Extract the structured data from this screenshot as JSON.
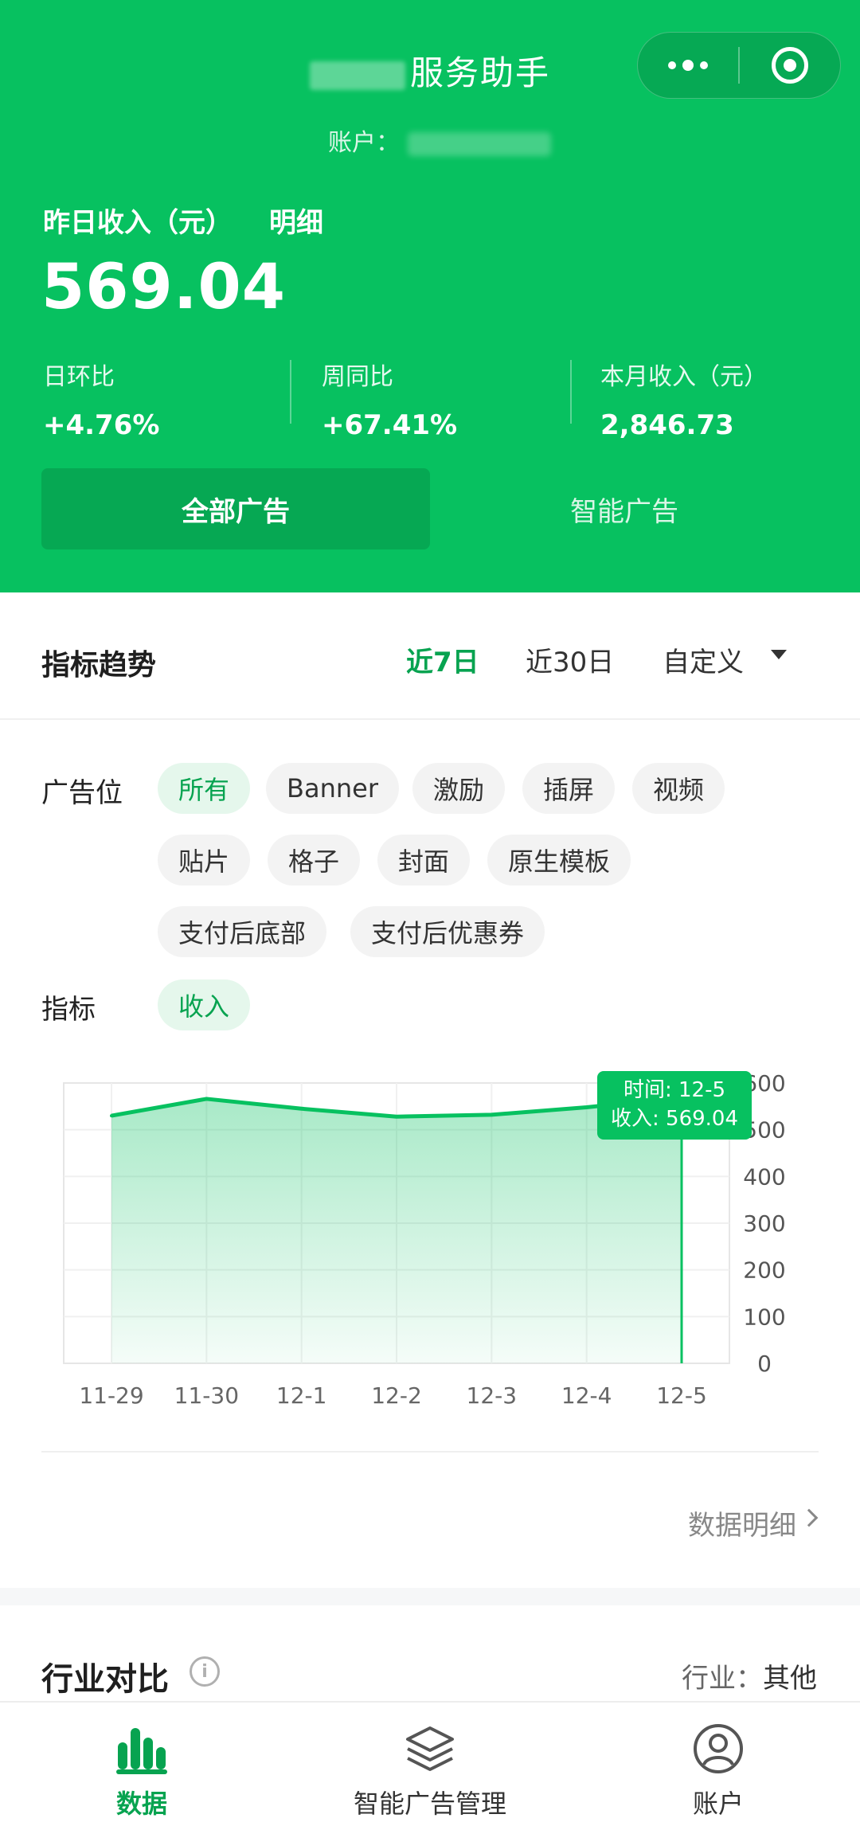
{
  "header": {
    "app_title": "服务助手",
    "account_label": "账户：",
    "yesterday_label": "昨日收入（元）",
    "detail_link": "明细",
    "yesterday_value": "569.04",
    "stats": [
      {
        "label": "日环比",
        "value": "+4.76%"
      },
      {
        "label": "周同比",
        "value": "+67.41%"
      },
      {
        "label": "本月收入（元）",
        "value": "2,846.73"
      }
    ],
    "segments": {
      "all": "全部广告",
      "smart": "智能广告"
    }
  },
  "trend": {
    "title": "指标趋势",
    "ranges": [
      "近7日",
      "近30日",
      "自定义"
    ],
    "selected_range": "近7日",
    "ad_position_label": "广告位",
    "ad_positions": [
      "所有",
      "Banner",
      "激励",
      "插屏",
      "视频",
      "贴片",
      "格子",
      "封面",
      "原生模板",
      "支付后底部",
      "支付后优惠券"
    ],
    "metric_label": "指标",
    "metric": "收入"
  },
  "chart_data": {
    "type": "area",
    "categories": [
      "11-29",
      "11-30",
      "12-1",
      "12-2",
      "12-3",
      "12-4",
      "12-5"
    ],
    "values": [
      530,
      566,
      545,
      528,
      532,
      548,
      569.04
    ],
    "yticks": [
      0,
      100,
      200,
      300,
      400,
      500,
      600
    ],
    "ylim": [
      0,
      600
    ],
    "tooltip": {
      "time_label": "时间: 12-5",
      "value_label": "收入: 569.04"
    },
    "color": "#07c160"
  },
  "data_detail_link": "数据明细",
  "industry": {
    "title": "行业对比",
    "meta_label": "行业：",
    "meta_value": "其他"
  },
  "tabbar": [
    {
      "label": "数据",
      "icon": "bar-chart-icon",
      "active": true
    },
    {
      "label": "智能广告管理",
      "icon": "layers-icon",
      "active": false
    },
    {
      "label": "账户",
      "icon": "user-circle-icon",
      "active": false
    }
  ]
}
